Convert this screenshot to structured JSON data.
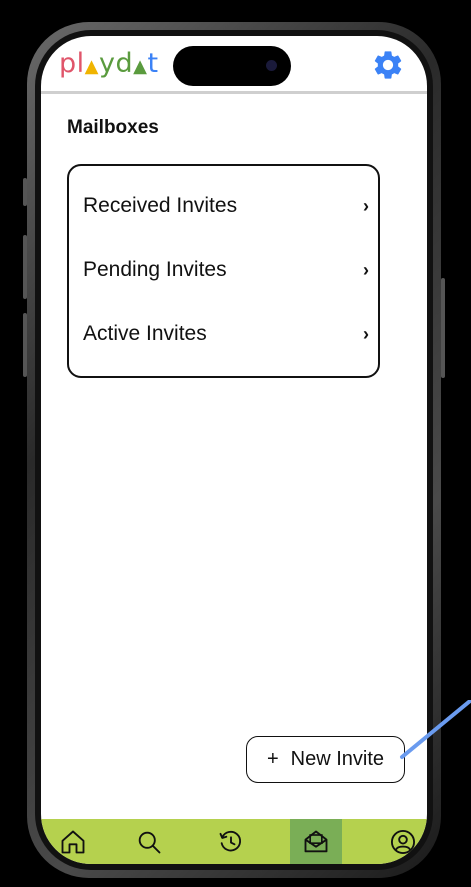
{
  "app": {
    "logo_letters": [
      "p",
      "l",
      "y",
      "d",
      "t"
    ]
  },
  "header": {
    "settings_icon": "gear-icon"
  },
  "mailboxes": {
    "title": "Mailboxes",
    "items": [
      {
        "label": "Received Invites",
        "chevron": "›"
      },
      {
        "label": "Pending Invites",
        "chevron": "›"
      },
      {
        "label": "Active Invites",
        "chevron": "›"
      }
    ]
  },
  "new_invite": {
    "plus": "+",
    "label": "New Invite"
  },
  "bottom_nav": {
    "items": [
      "home-icon",
      "search-icon",
      "history-icon",
      "mailbox-icon",
      "profile-icon"
    ],
    "active": "mailbox-icon"
  },
  "colors": {
    "nav_bg": "#b5d14e",
    "nav_active": "#7aae56",
    "gear": "#3b82f6",
    "logo_pink": "#e0556a",
    "logo_yellow": "#f0b400",
    "logo_green": "#5a9b3e",
    "logo_blue": "#3b82f6",
    "pointer": "#6a9bef"
  }
}
